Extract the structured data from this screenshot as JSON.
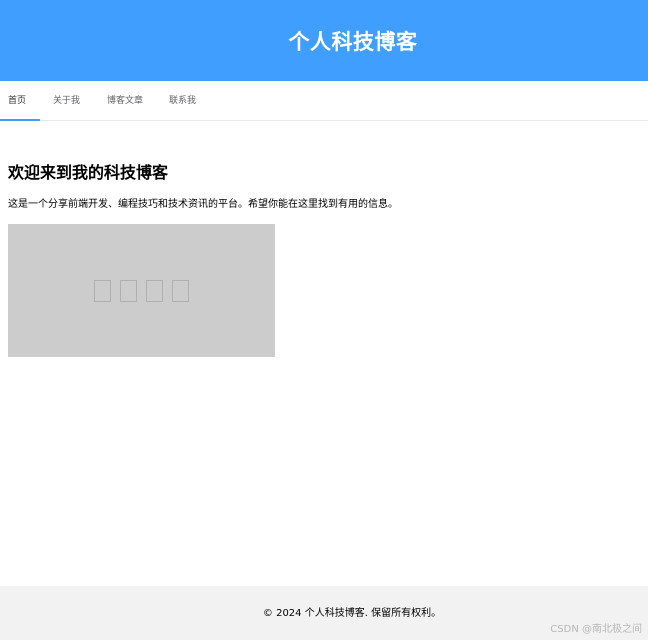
{
  "header": {
    "title": "个人科技博客"
  },
  "nav": {
    "tabs": [
      {
        "label": "首页",
        "active": true
      },
      {
        "label": "关于我",
        "active": false
      },
      {
        "label": "博客文章",
        "active": false
      },
      {
        "label": "联系我",
        "active": false
      }
    ]
  },
  "main": {
    "heading": "欢迎来到我的科技博客",
    "intro": "这是一个分享前端开发、编程技巧和技术资讯的平台。希望你能在这里找到有用的信息。",
    "image": {
      "alt_glyph_count": 4
    }
  },
  "footer": {
    "copyright": "© 2024 个人科技博客. 保留所有权利。"
  },
  "watermark": "CSDN @南北极之间",
  "colors": {
    "header_bg": "#409EFF",
    "accent": "#409EFF",
    "image_bg": "#cccccc",
    "footer_bg": "#f2f2f2"
  }
}
